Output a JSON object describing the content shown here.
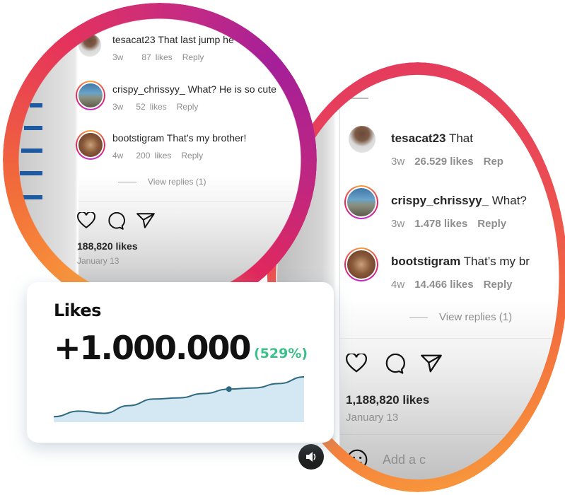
{
  "before": {
    "comments": [
      {
        "user": "tesacat23",
        "text": "That last jump he",
        "age": "3w",
        "likes": "87",
        "likes_label": "likes",
        "reply": "Reply"
      },
      {
        "user": "crispy_chrissyy_",
        "text": "What? He is so cute",
        "age": "3w",
        "likes": "52",
        "likes_label": "likes",
        "reply": "Reply"
      },
      {
        "user": "bootstigram",
        "text": "That’s my brother!",
        "age": "4w",
        "likes": "200",
        "likes_label": "likes",
        "reply": "Reply"
      }
    ],
    "view_replies": "View replies (1)",
    "post_likes": "188,820 likes",
    "date": "January 13"
  },
  "after": {
    "comments": [
      {
        "user": "tesacat23",
        "text": "That",
        "age": "3w",
        "likes": "26.529 likes",
        "reply": "Rep"
      },
      {
        "user": "crispy_chrissyy_",
        "text": "What?",
        "age": "3w",
        "likes": "1.478 likes",
        "reply": "Reply"
      },
      {
        "user": "bootstigram",
        "text": "That’s my br",
        "age": "4w",
        "likes": "14.466 likes",
        "reply": "Reply"
      }
    ],
    "view_replies": "View replies (1)",
    "post_likes": "1,188,820 likes",
    "date": "January 13",
    "add_comment_placeholder": "Add a c"
  },
  "card": {
    "title": "Likes",
    "value": "+1.000.000",
    "change_pct": "(529%)",
    "accent": "#3cc08a"
  },
  "chart_data": {
    "type": "area",
    "title": "Likes",
    "x": [
      0,
      1,
      2,
      3,
      4,
      5,
      6,
      7,
      8,
      9,
      10
    ],
    "values": [
      10,
      20,
      16,
      30,
      42,
      44,
      52,
      60,
      62,
      70,
      82
    ],
    "highlight_index": 7,
    "ylim": [
      0,
      100
    ],
    "grid": false,
    "line_color": "#2e6a82",
    "fill_color": "#d4e8f3"
  }
}
